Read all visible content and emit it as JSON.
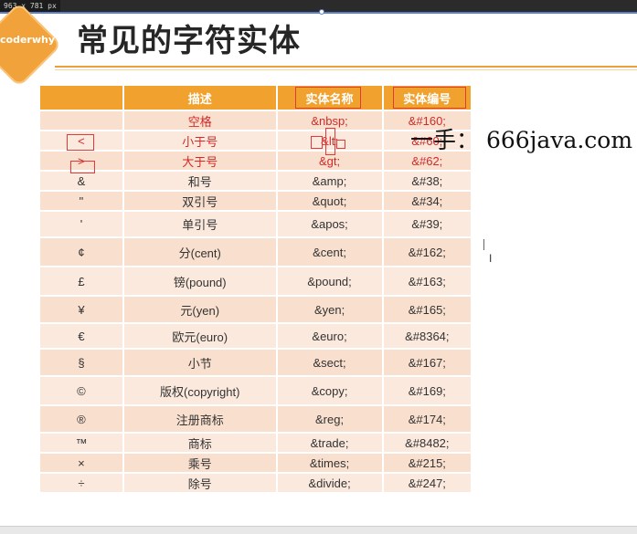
{
  "window": {
    "dimensions_label": "963 x 781  px"
  },
  "logo": {
    "text": "coderwhy"
  },
  "slide": {
    "title": "常见的字符实体"
  },
  "table": {
    "headers": [
      "",
      "描述",
      "实体名称",
      "实体编号"
    ],
    "rows": [
      {
        "sym": "",
        "desc": "空格",
        "name": "&nbsp;",
        "num": "&#160;"
      },
      {
        "sym": "<",
        "desc": "小于号",
        "name": "&lt;",
        "num": "&#60;"
      },
      {
        "sym": ">",
        "desc": "大于号",
        "name": "&gt;",
        "num": "&#62;"
      },
      {
        "sym": "&",
        "desc": "和号",
        "name": "&amp;",
        "num": "&#38;"
      },
      {
        "sym": "\"",
        "desc": "双引号",
        "name": "&quot;",
        "num": "&#34;"
      },
      {
        "sym": "'",
        "desc": "单引号",
        "name": "&apos;",
        "num": "&#39;"
      },
      {
        "sym": "¢",
        "desc": "分(cent)",
        "name": "&cent;",
        "num": "&#162;"
      },
      {
        "sym": "£",
        "desc": "镑(pound)",
        "name": "&pound;",
        "num": "&#163;"
      },
      {
        "sym": "¥",
        "desc": "元(yen)",
        "name": "&yen;",
        "num": "&#165;"
      },
      {
        "sym": "€",
        "desc": "欧元(euro)",
        "name": "&euro;",
        "num": "&#8364;"
      },
      {
        "sym": "§",
        "desc": "小节",
        "name": "&sect;",
        "num": "&#167;"
      },
      {
        "sym": "©",
        "desc": "版权(copyright)",
        "name": "&copy;",
        "num": "&#169;"
      },
      {
        "sym": "®",
        "desc": "注册商标",
        "name": "&reg;",
        "num": "&#174;"
      },
      {
        "sym": "™",
        "desc": "商标",
        "name": "&trade;",
        "num": "&#8482;"
      },
      {
        "sym": "×",
        "desc": "乘号",
        "name": "&times;",
        "num": "&#215;"
      },
      {
        "sym": "÷",
        "desc": "除号",
        "name": "&divide;",
        "num": "&#247;"
      }
    ]
  },
  "watermark": {
    "text": "一手：  666java.com"
  },
  "colors": {
    "accent": "#f0a12e",
    "annotation": "#e23a3a"
  }
}
